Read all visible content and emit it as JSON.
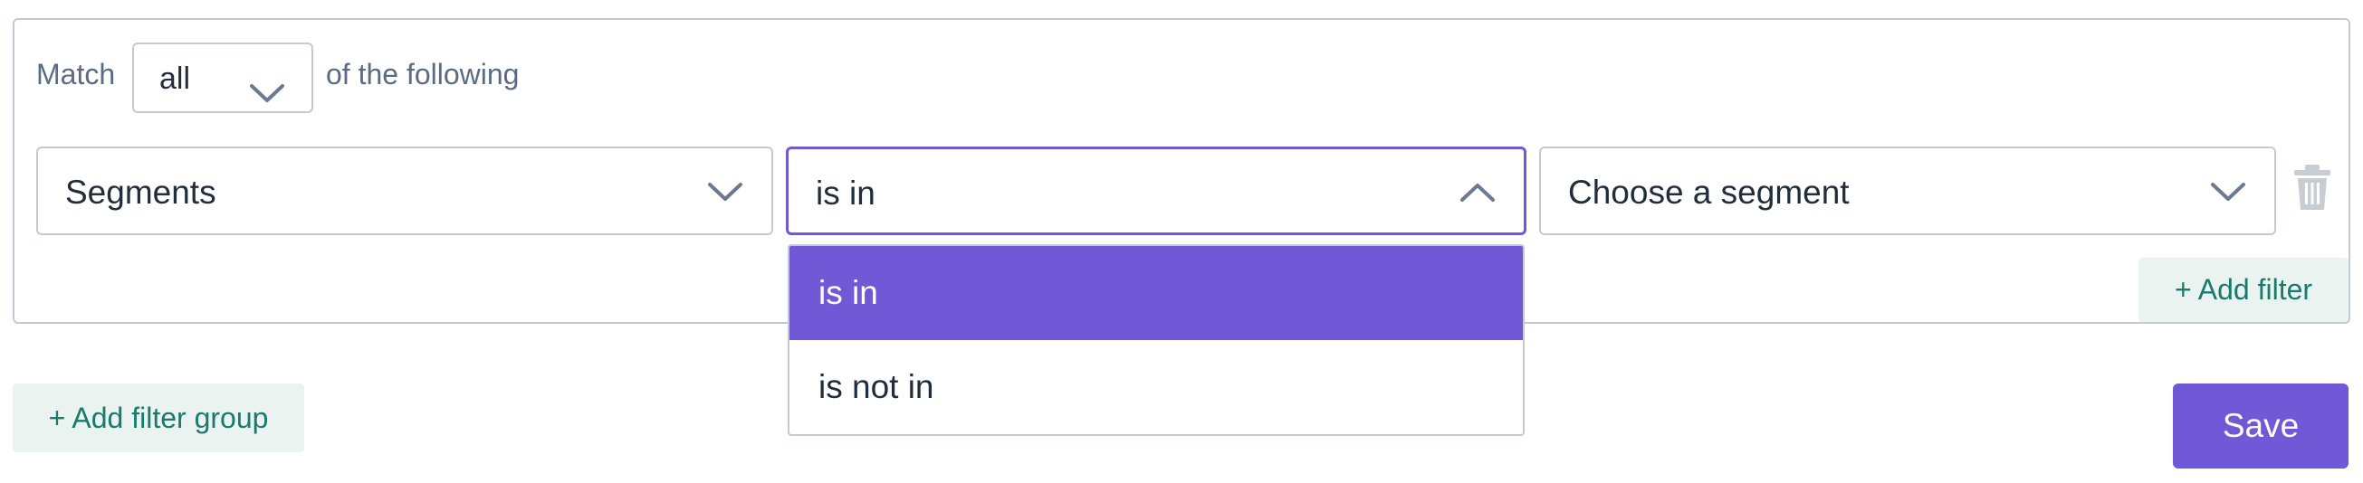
{
  "match": {
    "prefix": "Match",
    "value": "all",
    "suffix": "of the following",
    "icon": "chevron-down-icon"
  },
  "filter_row": {
    "field": {
      "value": "Segments",
      "icon": "chevron-down-icon"
    },
    "operator": {
      "value": "is in",
      "icon": "chevron-up-icon",
      "open": true
    },
    "segment": {
      "value": "Choose a segment",
      "icon": "chevron-down-icon"
    },
    "delete_icon": "trash-icon"
  },
  "operator_options": [
    {
      "label": "is in",
      "selected": true
    },
    {
      "label": "is not in",
      "selected": false
    }
  ],
  "add_filter_label": "+ Add filter",
  "add_filter_group_label": "+ Add filter group",
  "save_label": "Save",
  "colors": {
    "accent": "#7158d6",
    "secondary_bg": "#ebf3f0",
    "secondary_text": "#1a7a6c",
    "border": "#c3cad6"
  }
}
